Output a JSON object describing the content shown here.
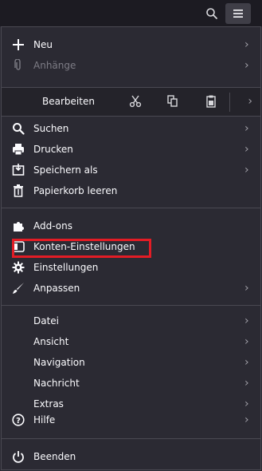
{
  "topbar": {
    "search_icon": "search-icon",
    "menu_icon": "hamburger-icon"
  },
  "menu": {
    "new": "Neu",
    "attachments": "Anhänge",
    "edit": "Bearbeiten",
    "search": "Suchen",
    "print": "Drucken",
    "save_as": "Speichern als",
    "empty_trash": "Papierkorb leeren",
    "addons": "Add-ons",
    "account_settings": "Konten-Einstellungen",
    "settings": "Einstellungen",
    "customize": "Anpassen",
    "file": "Datei",
    "view": "Ansicht",
    "navigation": "Navigation",
    "message": "Nachricht",
    "extras": "Extras",
    "help": "Hilfe",
    "quit": "Beenden"
  },
  "highlight_color": "#e31c25"
}
